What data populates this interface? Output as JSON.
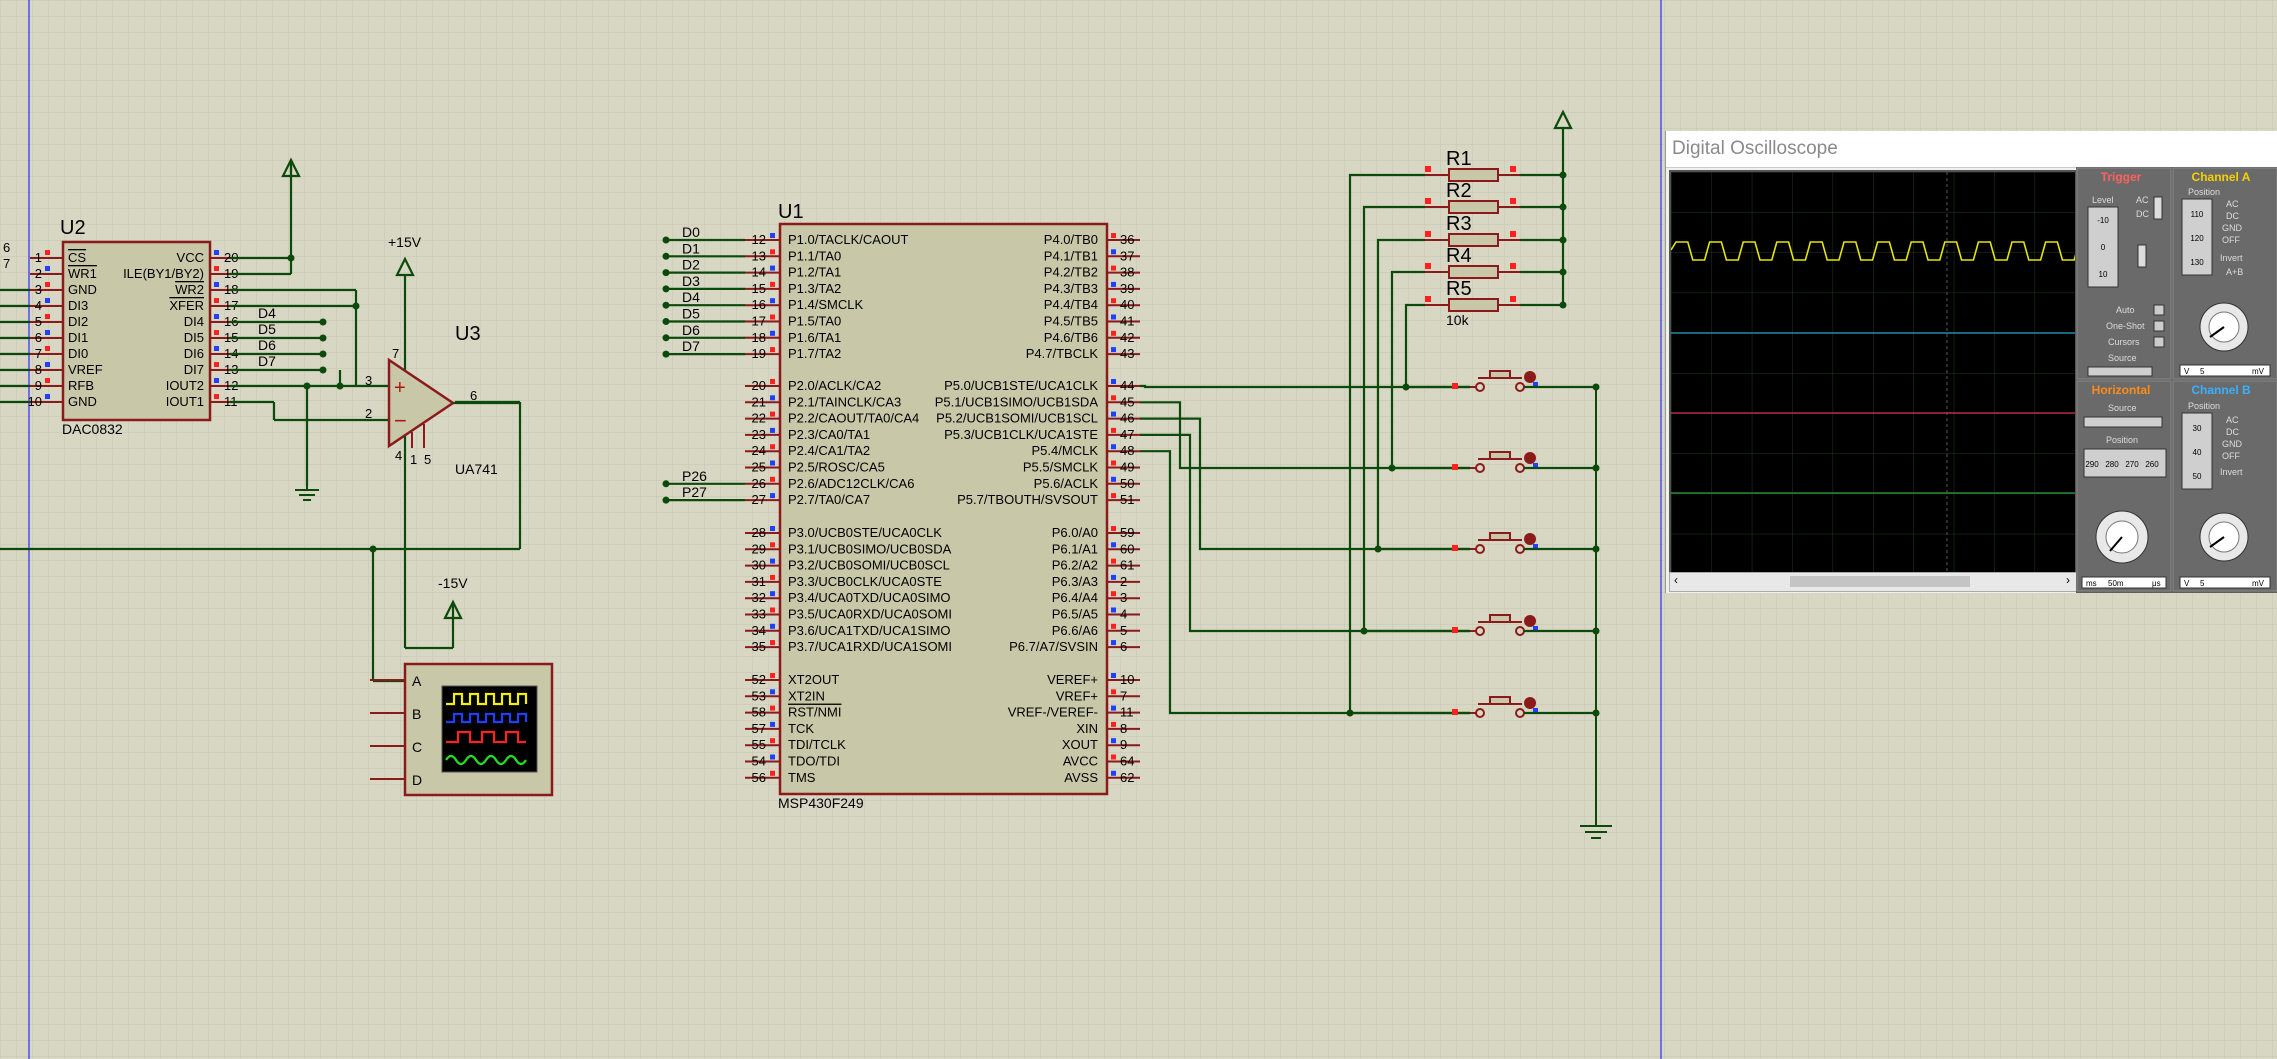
{
  "u2": {
    "ref": "U2",
    "part": "DAC0832",
    "left_pins": [
      {
        "num": "1",
        "name": "CS"
      },
      {
        "num": "2",
        "name": "WR1"
      },
      {
        "num": "3",
        "name": "GND"
      },
      {
        "num": "4",
        "name": "DI3"
      },
      {
        "num": "5",
        "name": "DI2"
      },
      {
        "num": "6",
        "name": "DI1"
      },
      {
        "num": "7",
        "name": "DI0"
      },
      {
        "num": "8",
        "name": "VREF"
      },
      {
        "num": "9",
        "name": "RFB"
      },
      {
        "num": "10",
        "name": "GND"
      }
    ],
    "right_pins": [
      {
        "num": "20",
        "name": "VCC"
      },
      {
        "num": "19",
        "name": "ILE(BY1/BY2)"
      },
      {
        "num": "18",
        "name": "WR2"
      },
      {
        "num": "17",
        "name": "XFER"
      },
      {
        "num": "16",
        "name": "DI4"
      },
      {
        "num": "15",
        "name": "DI5"
      },
      {
        "num": "14",
        "name": "DI6"
      },
      {
        "num": "13",
        "name": "DI7"
      },
      {
        "num": "12",
        "name": "IOUT2"
      },
      {
        "num": "11",
        "name": "IOUT1"
      }
    ],
    "edge_nums": [
      "6",
      "7"
    ],
    "net_labels": [
      "D4",
      "D5",
      "D6",
      "D7"
    ]
  },
  "u3": {
    "ref": "U3",
    "part": "UA741",
    "plus_supply": "+15V",
    "minus_supply": "-15V",
    "pin_nums": {
      "in_plus": "3",
      "in_minus": "2",
      "out": "6",
      "vplus": "7",
      "vminus": "4",
      "n1": "1",
      "n5": "5"
    }
  },
  "scope_symbol": {
    "channels": [
      "A",
      "B",
      "C",
      "D"
    ]
  },
  "u1": {
    "ref": "U1",
    "part": "MSP430F249",
    "left_groups": [
      [
        {
          "num": "12",
          "name": "P1.0/TACLK/CAOUT"
        },
        {
          "num": "13",
          "name": "P1.1/TA0"
        },
        {
          "num": "14",
          "name": "P1.2/TA1"
        },
        {
          "num": "15",
          "name": "P1.3/TA2"
        },
        {
          "num": "16",
          "name": "P1.4/SMCLK"
        },
        {
          "num": "17",
          "name": "P1.5/TA0"
        },
        {
          "num": "18",
          "name": "P1.6/TA1"
        },
        {
          "num": "19",
          "name": "P1.7/TA2"
        }
      ],
      [
        {
          "num": "20",
          "name": "P2.0/ACLK/CA2"
        },
        {
          "num": "21",
          "name": "P2.1/TAINCLK/CA3"
        },
        {
          "num": "22",
          "name": "P2.2/CAOUT/TA0/CA4"
        },
        {
          "num": "23",
          "name": "P2.3/CA0/TA1"
        },
        {
          "num": "24",
          "name": "P2.4/CA1/TA2"
        },
        {
          "num": "25",
          "name": "P2.5/ROSC/CA5"
        },
        {
          "num": "26",
          "name": "P2.6/ADC12CLK/CA6"
        },
        {
          "num": "27",
          "name": "P2.7/TA0/CA7"
        }
      ],
      [
        {
          "num": "28",
          "name": "P3.0/UCB0STE/UCA0CLK"
        },
        {
          "num": "29",
          "name": "P3.1/UCB0SIMO/UCB0SDA"
        },
        {
          "num": "30",
          "name": "P3.2/UCB0SOMI/UCB0SCL"
        },
        {
          "num": "31",
          "name": "P3.3/UCB0CLK/UCA0STE"
        },
        {
          "num": "32",
          "name": "P3.4/UCA0TXD/UCA0SIMO"
        },
        {
          "num": "33",
          "name": "P3.5/UCA0RXD/UCA0SOMI"
        },
        {
          "num": "34",
          "name": "P3.6/UCA1TXD/UCA1SIMO"
        },
        {
          "num": "35",
          "name": "P3.7/UCA1RXD/UCA1SOMI"
        }
      ],
      [
        {
          "num": "52",
          "name": "XT2OUT"
        },
        {
          "num": "53",
          "name": "XT2IN"
        },
        {
          "num": "58",
          "name": "RST/NMI"
        },
        {
          "num": "57",
          "name": "TCK"
        },
        {
          "num": "55",
          "name": "TDI/TCLK"
        },
        {
          "num": "54",
          "name": "TDO/TDI"
        },
        {
          "num": "56",
          "name": "TMS"
        }
      ]
    ],
    "right_groups": [
      [
        {
          "num": "36",
          "name": "P4.0/TB0"
        },
        {
          "num": "37",
          "name": "P4.1/TB1"
        },
        {
          "num": "38",
          "name": "P4.2/TB2"
        },
        {
          "num": "39",
          "name": "P4.3/TB3"
        },
        {
          "num": "40",
          "name": "P4.4/TB4"
        },
        {
          "num": "41",
          "name": "P4.5/TB5"
        },
        {
          "num": "42",
          "name": "P4.6/TB6"
        },
        {
          "num": "43",
          "name": "P4.7/TBCLK"
        }
      ],
      [
        {
          "num": "44",
          "name": "P5.0/UCB1STE/UCA1CLK"
        },
        {
          "num": "45",
          "name": "P5.1/UCB1SIMO/UCB1SDA"
        },
        {
          "num": "46",
          "name": "P5.2/UCB1SOMI/UCB1SCL"
        },
        {
          "num": "47",
          "name": "P5.3/UCB1CLK/UCA1STE"
        },
        {
          "num": "48",
          "name": "P5.4/MCLK"
        },
        {
          "num": "49",
          "name": "P5.5/SMCLK"
        },
        {
          "num": "50",
          "name": "P5.6/ACLK"
        },
        {
          "num": "51",
          "name": "P5.7/TBOUTH/SVSOUT"
        }
      ],
      [
        {
          "num": "59",
          "name": "P6.0/A0"
        },
        {
          "num": "60",
          "name": "P6.1/A1"
        },
        {
          "num": "61",
          "name": "P6.2/A2"
        },
        {
          "num": "2",
          "name": "P6.3/A3"
        },
        {
          "num": "3",
          "name": "P6.4/A4"
        },
        {
          "num": "4",
          "name": "P6.5/A5"
        },
        {
          "num": "5",
          "name": "P6.6/A6"
        },
        {
          "num": "6",
          "name": "P6.7/A7/SVSIN"
        }
      ],
      [
        {
          "num": "10",
          "name": "VEREF+"
        },
        {
          "num": "7",
          "name": "VREF+"
        },
        {
          "num": "11",
          "name": "VREF-/VEREF-"
        },
        {
          "num": "8",
          "name": "XIN"
        },
        {
          "num": "9",
          "name": "XOUT"
        },
        {
          "num": "64",
          "name": "AVCC"
        },
        {
          "num": "62",
          "name": "AVSS"
        }
      ]
    ],
    "p1_nets": [
      "D0",
      "D1",
      "D2",
      "D3",
      "D4",
      "D5",
      "D6",
      "D7"
    ],
    "p2_nets": [
      "P26",
      "P27"
    ]
  },
  "resistors": {
    "refs": [
      "R1",
      "R2",
      "R3",
      "R4",
      "R5"
    ],
    "value": "10k"
  },
  "oscilloscope": {
    "title": "Digital Oscilloscope",
    "trigger_label": "Trigger",
    "channel_a_label": "Channel A",
    "channel_b_label": "Channel B",
    "horizontal_label": "Horizontal",
    "trigger": {
      "level": "Level",
      "ac": "AC",
      "dc": "DC",
      "auto": "Auto",
      "one_shot": "One-Shot",
      "cursors": "Cursors",
      "source": "Source",
      "marks": [
        "-10",
        "0",
        "10"
      ]
    },
    "channel": {
      "position": "Position",
      "ac": "AC",
      "dc": "DC",
      "gnd": "GND",
      "off": "OFF",
      "invert": "Invert",
      "a_plus_b": "A+B",
      "marks_a": [
        "110",
        "120",
        "130"
      ],
      "marks_b": [
        "30",
        "40",
        "50"
      ],
      "volts_units": [
        "V",
        "5",
        "mV"
      ]
    },
    "horizontal": {
      "source": "Source",
      "position": "Position",
      "marks": [
        "290",
        "280",
        "270",
        "260"
      ],
      "units": [
        "ms",
        "50m",
        "μs"
      ]
    },
    "colors": {
      "trace_a": "#e6e600",
      "trace_b": "#2aa6c8",
      "trace_c": "#d8305a",
      "trace_d": "#2e9c3a",
      "channel_label": "#f5d000",
      "trigger_label": "#ff6060",
      "horizontal_label": "#ff8c1a",
      "channel_b_label": "#3ab0ff"
    }
  }
}
